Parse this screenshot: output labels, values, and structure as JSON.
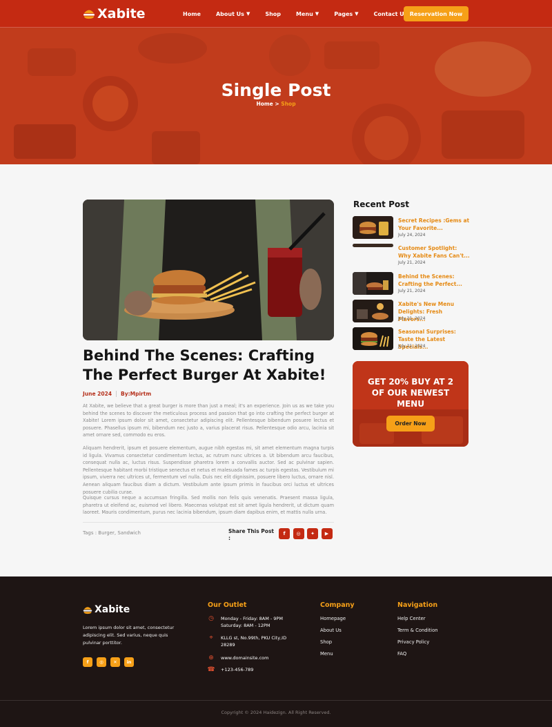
{
  "header": {
    "brand": "Xabite",
    "nav": [
      {
        "label": "Home",
        "dropdown": false
      },
      {
        "label": "About Us",
        "dropdown": true
      },
      {
        "label": "Shop",
        "dropdown": false
      },
      {
        "label": "Menu",
        "dropdown": true
      },
      {
        "label": "Pages",
        "dropdown": true
      },
      {
        "label": "Contact Us",
        "dropdown": false
      }
    ],
    "cta": "Reservation Now"
  },
  "hero": {
    "title": "Single Post",
    "crumb_home": "Home",
    "crumb_sep": " > ",
    "crumb_current": "Shop"
  },
  "post": {
    "title": "Behind The Scenes: Crafting The Perfect Burger At Xabite!",
    "date": "June 2024",
    "author": "By:Mpirtm",
    "paragraphs": [
      "At Xabite, we believe that a great burger is more than just a meal; it's an experience. Join us as we take you behind the scenes to discover the meticulous process and passion that go into crafting the perfect burger at Xabite! Lorem ipsum dolor sit amet, consectetur adipiscing elit. Pellentesque bibendum posuere lectus et posuere. Phasellus ipsum mi, bibendum nec justo a, varius placerat risus. Pellentesque odio arcu, lacinia sit amet ornare sed, commodo eu eros.",
      "Aliquam hendrerit, ipsum et posuere elementum, augue nibh egestas mi, sit amet elementum magna turpis id ligula. Vivamus consectetur condimentum lectus, ac rutrum nunc ultrices a. Ut bibendum arcu faucibus, consequat nulla ac, luctus risus. Suspendisse pharetra lorem a convallis auctor. Sed ac pulvinar sapien. Pellentesque habitant morbi tristique senectus et netus et malesuada fames ac turpis egestas. Vestibulum mi ipsum, viverra nec ultrices ut, fermentum vel nulla. Duis nec elit dignissim, posuere libero luctus, ornare nisl. Aenean aliquam faucibus diam a dictum. Vestibulum ante ipsum primis in faucibus orci luctus et ultrices posuere cubilia curae.",
      "Quisque cursus neque a accumsan fringilla. Sed mollis non felis quis venenatis. Praesent massa ligula, pharetra ut eleifend ac, euismod vel libero. Maecenas volutpat est sit amet ligula hendrerit, ut dictum quam laoreet. Mauris condimentum, purus nec lacinia bibendum, ipsum diam dapibus enim, et mattis nulla urna."
    ],
    "tags": "Tags : Burger, Sandwich",
    "share_label": "Share This Post :",
    "share_icons": [
      "facebook-icon",
      "instagram-icon",
      "twitter-icon",
      "youtube-icon"
    ]
  },
  "sidebar": {
    "title": "Recent Post",
    "posts": [
      {
        "title": "Secret Recipes :Gems at Your Favorite...",
        "date": "July 24, 2024"
      },
      {
        "title": "Customer Spotlight: Why Xabite Fans Can't...",
        "date": "July 21, 2024"
      },
      {
        "title": "Behind the Scenes: Crafting the Perfect...",
        "date": "July 21, 2024"
      },
      {
        "title": "Xabite's New Menu Delights: Fresh Flavors...",
        "date": "July 21, 2024"
      },
      {
        "title": "Seasonal Surprises: Taste the Latest Specials...",
        "date": "July 21, 2024"
      }
    ],
    "promo": {
      "line1": "GET 20% BUY AT 2",
      "line2": "OF OUR NEWEST",
      "line3": "MENU",
      "button": "Order Now"
    }
  },
  "footer": {
    "brand": "Xabite",
    "about": "Lorem ipsum dolor sit amet, consectetur adipiscing elit. Sed varius, neque quis pulvinar porttitor.",
    "social": [
      "facebook-icon",
      "instagram-icon",
      "x-icon",
      "linkedin-icon"
    ],
    "outlet": {
      "title": "Our Outlet",
      "hours_1": "Monday - Friday: 8AM - 9PM",
      "hours_2": "Saturday: 8AM - 12PM",
      "address": "KLLG st, No.99th, PKU City,ID 28289",
      "web": "www.domainsite.com",
      "phone": "+123-456-789"
    },
    "company": {
      "title": "Company",
      "links": [
        "Homepage",
        "About Us",
        "Shop",
        "Menu"
      ]
    },
    "navigation": {
      "title": "Navigation",
      "links": [
        "Help Center",
        "Term & Condition",
        "Privacy Policy",
        "FAQ"
      ]
    },
    "copyright": "Copyright © 2024 Haidezign. All Right Reserved."
  },
  "colors": {
    "primary": "#c42a12",
    "accent": "#f6a018",
    "footer_bg": "#1e1514"
  }
}
